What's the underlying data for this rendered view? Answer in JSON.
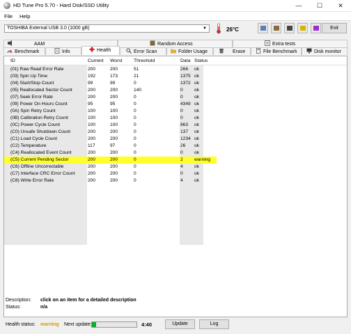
{
  "window": {
    "title": "HD Tune Pro 5.70 - Hard Disk/SSD Utility"
  },
  "menu": [
    {
      "label": "File"
    },
    {
      "label": "Help"
    }
  ],
  "toolbar": {
    "drive": "TOSHIBA External USB 3.0 (1000 gB)",
    "temperature": "26°C",
    "exit_label": "Exit"
  },
  "tabs_top": [
    {
      "label": "AAM"
    },
    {
      "label": "Random Access"
    },
    {
      "label": "Extra tests"
    }
  ],
  "tabs_bottom": [
    {
      "label": "Benchmark"
    },
    {
      "label": "Info"
    },
    {
      "label": "Health"
    },
    {
      "label": "Error Scan"
    },
    {
      "label": "Folder Usage"
    },
    {
      "label": "Erase"
    },
    {
      "label": "File Benchmark"
    },
    {
      "label": "Disk monitor"
    }
  ],
  "table": {
    "headers": [
      "ID",
      "Current",
      "Worst",
      "Threshold",
      "Data",
      "Status"
    ],
    "rows": [
      [
        "(01) Raw Read Error Rate",
        "200",
        "200",
        "51",
        "266",
        "ok"
      ],
      [
        "(03) Spin Up Time",
        "192",
        "173",
        "21",
        "1375",
        "ok"
      ],
      [
        "(04) Start/Stop Count",
        "99",
        "99",
        "0",
        "1372",
        "ok"
      ],
      [
        "(05) Reallocated Sector Count",
        "200",
        "200",
        "140",
        "0",
        "ok"
      ],
      [
        "(07) Seek Error Rate",
        "200",
        "200",
        "0",
        "0",
        "ok"
      ],
      [
        "(09) Power On Hours Count",
        "95",
        "95",
        "0",
        "4349",
        "ok"
      ],
      [
        "(0A) Spin Retry Count",
        "100",
        "100",
        "0",
        "0",
        "ok"
      ],
      [
        "(0B) Calibration Retry Count",
        "100",
        "100",
        "0",
        "0",
        "ok"
      ],
      [
        "(0C) Power Cycle Count",
        "100",
        "100",
        "0",
        "863",
        "ok"
      ],
      [
        "(C0) Unsafe Shutdown Count",
        "200",
        "200",
        "0",
        "137",
        "ok"
      ],
      [
        "(C1) Load Cycle Count",
        "200",
        "200",
        "0",
        "1234",
        "ok"
      ],
      [
        "(C2) Temperature",
        "117",
        "97",
        "0",
        "26",
        "ok"
      ],
      [
        "(C4) Reallocated Event Count",
        "200",
        "200",
        "0",
        "0",
        "ok"
      ],
      [
        "(C5) Current Pending Sector",
        "200",
        "200",
        "0",
        "2",
        "warning"
      ],
      [
        "(C6) Offline Uncorrectable",
        "200",
        "200",
        "0",
        "4",
        "ok"
      ],
      [
        "(C7) Interface CRC Error Count",
        "200",
        "200",
        "0",
        "0",
        "ok"
      ],
      [
        "(C8) Write Error Rate",
        "200",
        "200",
        "0",
        "4",
        "ok"
      ]
    ]
  },
  "description": {
    "desc_label": "Description:",
    "desc_value": "click on an item for a detailed description",
    "status_label": "Status:",
    "status_value": "n/a"
  },
  "statusbar": {
    "health_label": "Health status:",
    "health_value": "warning",
    "next_update_label": "Next update:",
    "progress_fraction": 0.1,
    "countdown": "4:40",
    "update_label": "Update",
    "log_label": "Log"
  },
  "colors": {
    "warning_row": "#ffff2a",
    "health_warning": "#d4a000",
    "progress": "#07b025"
  }
}
